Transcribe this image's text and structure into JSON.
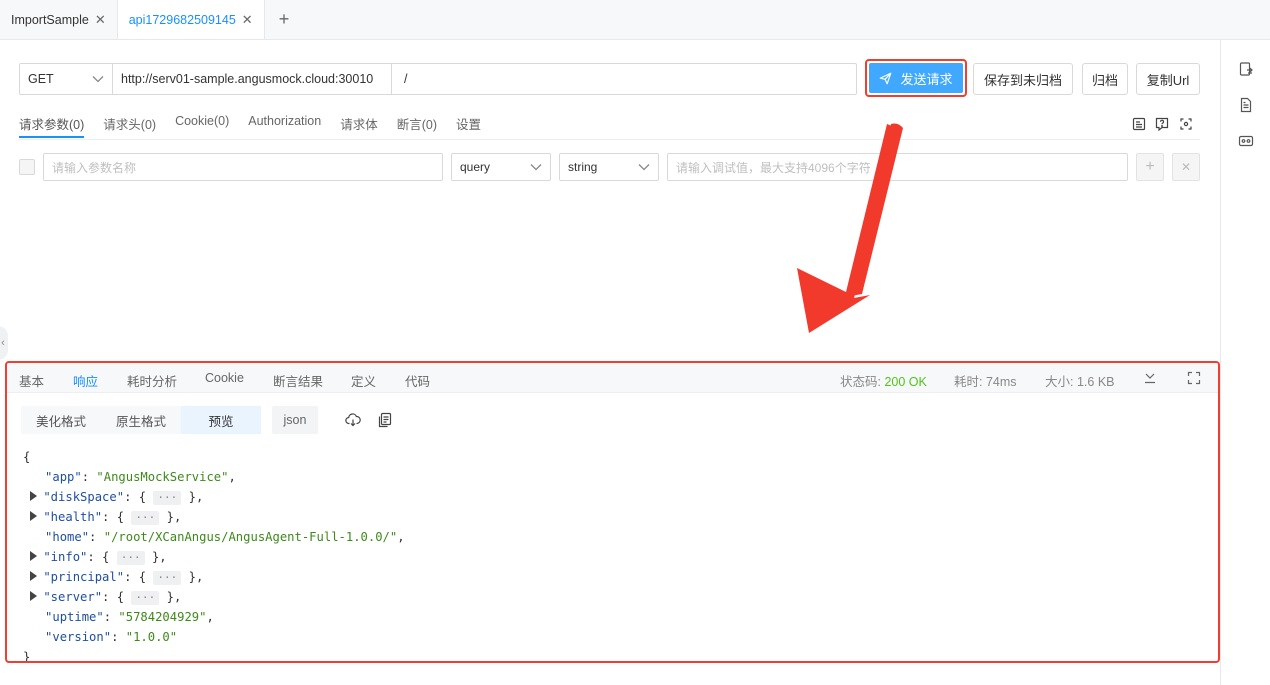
{
  "tabs": [
    {
      "label": "ImportSample",
      "close": "✕"
    },
    {
      "label": "api1729682509145",
      "close": "✕"
    }
  ],
  "tab_add": "+",
  "request": {
    "method": "GET",
    "url": "http://serv01-sample.angusmock.cloud:30010",
    "path": "/",
    "send_label": "发送请求",
    "save_unarchived_label": "保存到未归档",
    "archive_label": "归档",
    "copy_url_label": "复制Url"
  },
  "param_tabs": [
    "请求参数(0)",
    "请求头(0)",
    "Cookie(0)",
    "Authorization",
    "请求体",
    "断言(0)",
    "设置"
  ],
  "param_row": {
    "name_placeholder": "请输入参数名称",
    "in": "query",
    "type": "string",
    "value_placeholder": "请输入调试值，最大支持4096个字符",
    "add": "+",
    "remove": "✕"
  },
  "response": {
    "tabs": [
      "基本",
      "响应",
      "耗时分析",
      "Cookie",
      "断言结果",
      "定义",
      "代码"
    ],
    "active_tab": "响应",
    "status_label": "状态码:",
    "status_value": "200 OK",
    "time_label": "耗时:",
    "time_value": "74ms",
    "size_label": "大小:",
    "size_value": "1.6 KB",
    "formats": [
      "美化格式",
      "原生格式",
      "预览"
    ],
    "selected_format": "预览",
    "json_label": "json",
    "json_lines": {
      "open": "{",
      "app_key": "\"app\"",
      "app_val": "\"AngusMockService\"",
      "diskSpace_key": "\"diskSpace\"",
      "health_key": "\"health\"",
      "home_key": "\"home\"",
      "home_val": "\"/root/XCanAngus/AngusAgent-Full-1.0.0/\"",
      "info_key": "\"info\"",
      "principal_key": "\"principal\"",
      "server_key": "\"server\"",
      "uptime_key": "\"uptime\"",
      "uptime_val": "\"5784204929\"",
      "version_key": "\"version\"",
      "version_val": "\"1.0.0\"",
      "ellipsis": "···",
      "close": "}"
    }
  },
  "colors": {
    "accent": "#1890ff",
    "send_bg": "#40a9ff",
    "highlight_red": "#f03e2f",
    "status_ok": "#52c41a"
  }
}
